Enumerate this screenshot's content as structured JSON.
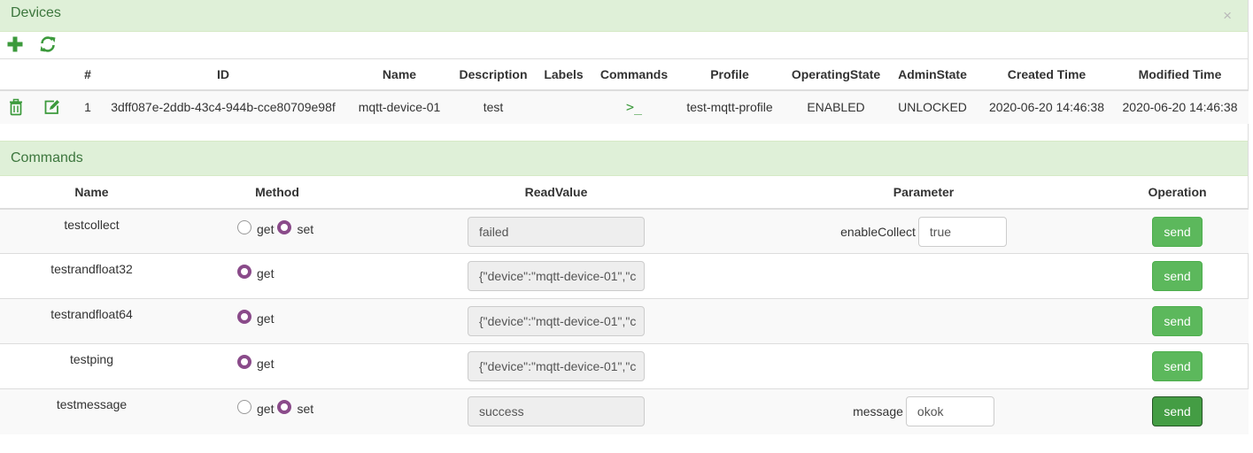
{
  "devices": {
    "title": "Devices",
    "close": "×",
    "columns": [
      "#",
      "ID",
      "Name",
      "Description",
      "Labels",
      "Commands",
      "Profile",
      "OperatingState",
      "AdminState",
      "Created Time",
      "Modified Time"
    ],
    "rows": [
      {
        "index": "1",
        "id": "3dff087e-2ddb-43c4-944b-cce80709e98f",
        "name": "mqtt-device-01",
        "description": "test",
        "labels": "",
        "commands_glyph": ">_",
        "profile": "test-mqtt-profile",
        "operating_state": "ENABLED",
        "admin_state": "UNLOCKED",
        "created": "2020-06-20 14:46:38",
        "modified": "2020-06-20 14:46:38"
      }
    ]
  },
  "commands": {
    "title": "Commands",
    "columns": [
      "Name",
      "Method",
      "ReadValue",
      "Parameter",
      "Operation"
    ],
    "rows": [
      {
        "name": "testcollect",
        "get_label": "get",
        "set_label": "set",
        "read_value": "failed",
        "param_label": "enableCollect",
        "param_value": "true",
        "send_label": "send"
      },
      {
        "name": "testrandfloat32",
        "get_label": "get",
        "read_value": "{\"device\":\"mqtt-device-01\",\"c",
        "send_label": "send"
      },
      {
        "name": "testrandfloat64",
        "get_label": "get",
        "read_value": "{\"device\":\"mqtt-device-01\",\"c",
        "send_label": "send"
      },
      {
        "name": "testping",
        "get_label": "get",
        "read_value": "{\"device\":\"mqtt-device-01\",\"c",
        "send_label": "send"
      },
      {
        "name": "testmessage",
        "get_label": "get",
        "set_label": "set",
        "read_value": "success",
        "param_label": "message",
        "param_value": "okok",
        "send_label": "send"
      }
    ]
  },
  "icons": {
    "add": "plus-icon",
    "refresh": "refresh-icon",
    "delete": "trash-icon",
    "edit": "edit-icon",
    "commands": "terminal-icon"
  },
  "colors": {
    "accent": "#5cb85c",
    "heading_bg": "#dff0d8",
    "heading_text": "#3c763d",
    "radio_selected": "#8a4b8a"
  }
}
